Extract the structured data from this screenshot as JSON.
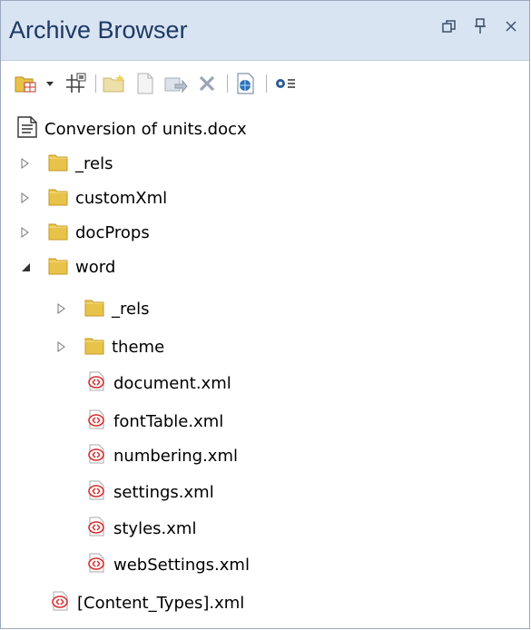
{
  "panel": {
    "title": "Archive Browser",
    "window_controls": [
      "restore-icon",
      "pin-icon",
      "close-icon"
    ]
  },
  "toolbar": {
    "buttons": [
      "new-archive-icon",
      "dropdown-arrow-icon",
      "grid-icon",
      "new-folder-icon",
      "new-file-icon",
      "add-file-icon",
      "delete-icon",
      "web-icon",
      "settings-menu-icon"
    ]
  },
  "tree": {
    "root": {
      "label": "Conversion of units.docx",
      "icon": "document-icon"
    },
    "items": [
      {
        "label": "_rels",
        "type": "folder",
        "expanded": false
      },
      {
        "label": "customXml",
        "type": "folder",
        "expanded": false
      },
      {
        "label": "docProps",
        "type": "folder",
        "expanded": false
      },
      {
        "label": "word",
        "type": "folder",
        "expanded": true
      }
    ],
    "word_children": [
      {
        "label": "_rels",
        "type": "folder",
        "expanded": false
      },
      {
        "label": "theme",
        "type": "folder",
        "expanded": false
      },
      {
        "label": "document.xml",
        "type": "xml"
      },
      {
        "label": "fontTable.xml",
        "type": "xml"
      },
      {
        "label": "numbering.xml",
        "type": "xml"
      },
      {
        "label": "settings.xml",
        "type": "xml"
      },
      {
        "label": "styles.xml",
        "type": "xml"
      },
      {
        "label": "webSettings.xml",
        "type": "xml"
      }
    ],
    "content_types": {
      "label": "[Content_Types].xml",
      "type": "xml"
    }
  },
  "colors": {
    "title_bar": "#d9e4f3",
    "title_text": "#1e3963",
    "folder": "#e8c34a",
    "xml_icon": "#d62d2d"
  }
}
